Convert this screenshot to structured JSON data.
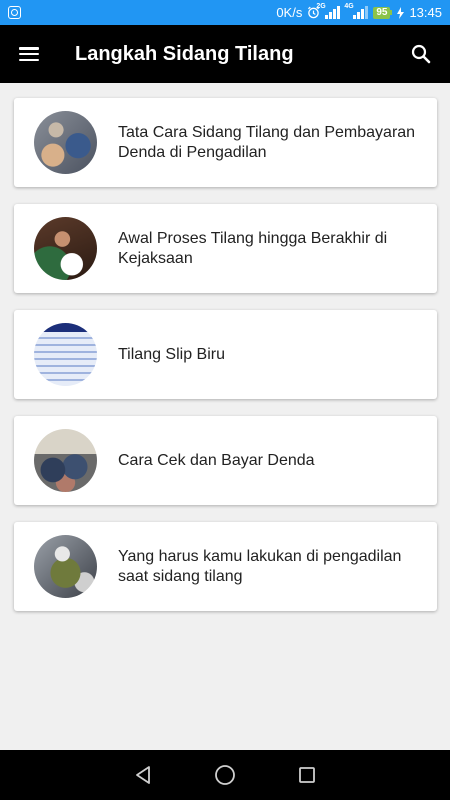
{
  "status_bar": {
    "speed": "0K/s",
    "net_tag_1": "2G",
    "net_tag_2": "4G",
    "battery": "95",
    "time": "13:45",
    "color": "#2196f3"
  },
  "app_bar": {
    "title": "Langkah Sidang Tilang",
    "menu_icon": "hamburger-menu-icon",
    "search_icon": "search-icon",
    "color": "#000000"
  },
  "items": [
    {
      "title": "Tata Cara Sidang Tilang dan Pembayaran Denda di Pengadilan"
    },
    {
      "title": "Awal Proses Tilang hingga Berakhir di Kejaksaan"
    },
    {
      "title": "Tilang Slip Biru"
    },
    {
      "title": "Cara Cek dan Bayar Denda"
    },
    {
      "title": "Yang harus kamu lakukan di pengadilan saat sidang tilang"
    }
  ],
  "nav_bar": {
    "back_icon": "back-triangle-icon",
    "home_icon": "home-circle-icon",
    "recents_icon": "recents-square-icon"
  }
}
